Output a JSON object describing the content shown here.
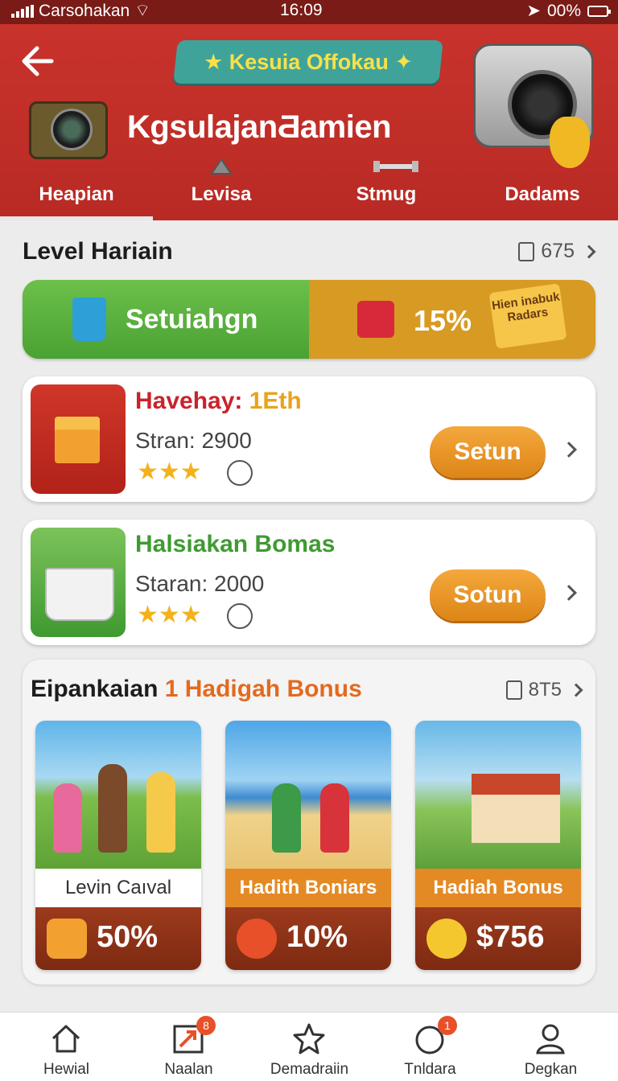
{
  "status_bar": {
    "carrier": "Carsohakan",
    "time": "16:09",
    "battery": "00%"
  },
  "header": {
    "banner": "★ Kesuia Offokau ✦",
    "title": "KgsulajanƋamien",
    "tabs": [
      {
        "label": "Heapian",
        "active": true
      },
      {
        "label": "Levisa",
        "active": false
      },
      {
        "label": "Stmug",
        "active": false
      },
      {
        "label": "Dadams",
        "active": false
      }
    ]
  },
  "level": {
    "title": "Level Hariain",
    "count": "675",
    "progress_label": "Setuiahgn",
    "progress_percent": "15%",
    "progress_value": 0.5,
    "note": "Hien inabuk Radars"
  },
  "offers": [
    {
      "title_a": "Havehay:",
      "title_b": " 1Eth",
      "stat": "Stran: 2900",
      "stars": "★★★",
      "button": "Setun"
    },
    {
      "title": "Halsiakan Bomas",
      "stat": "Staran: 2000",
      "stars": "★★★",
      "button": "Sotun"
    }
  ],
  "bonus": {
    "title_a": "Eipankaian",
    "title_b": " 1 Hadigah Bonus",
    "count": "8T5",
    "tiles": [
      {
        "caption": "Levin Caıval",
        "value": "50%"
      },
      {
        "caption": "Hadith Boniars",
        "value": "10%"
      },
      {
        "caption": "Hadiah Bonus",
        "value": "$756"
      }
    ]
  },
  "bottom_nav": [
    {
      "label": "Hewial",
      "badge": ""
    },
    {
      "label": "Naalan",
      "badge": "8"
    },
    {
      "label": "Demadraiin",
      "badge": ""
    },
    {
      "label": "Tnldara",
      "badge": "1"
    },
    {
      "label": "Degkan",
      "badge": ""
    }
  ],
  "colors": {
    "header_red": "#c8332c",
    "progress_green": "#5bb33d",
    "progress_orange": "#d79a23",
    "button_orange": "#e99327",
    "reward_brown": "#8e3318"
  }
}
